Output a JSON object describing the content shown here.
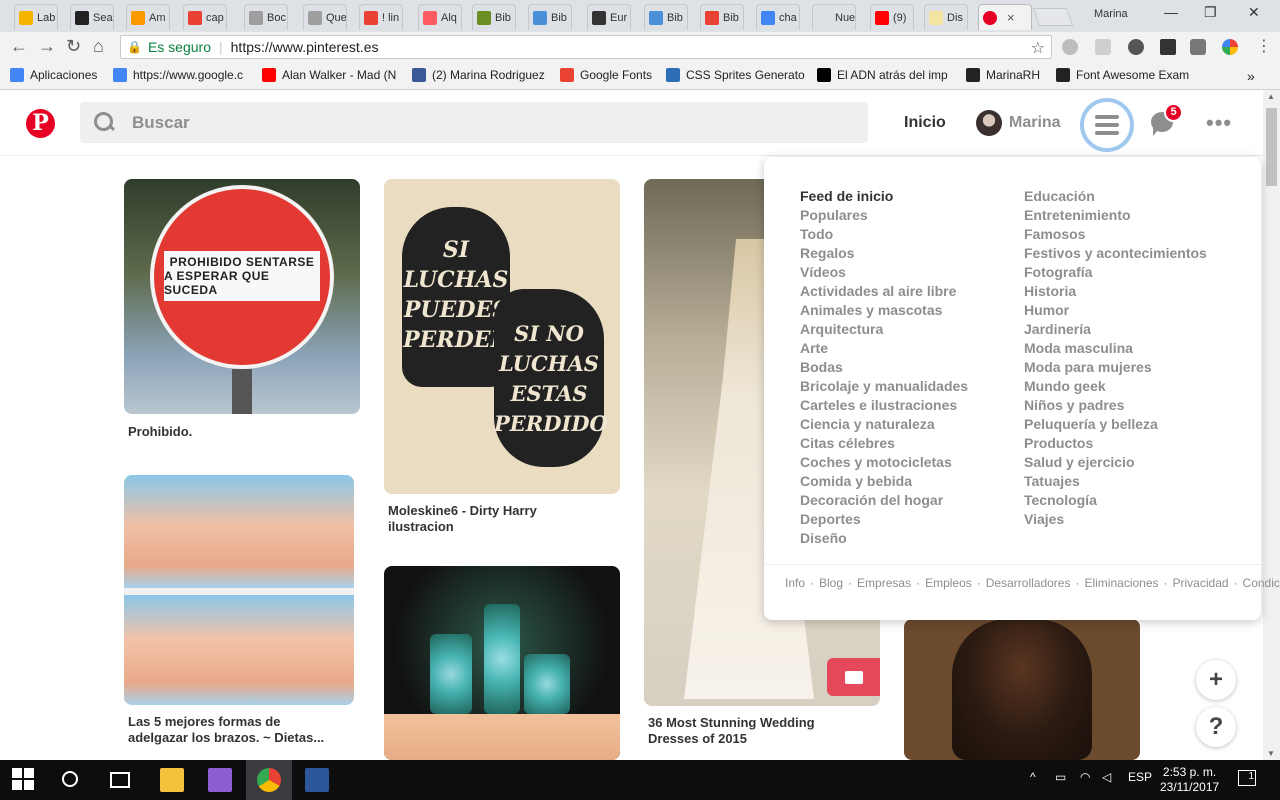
{
  "browser": {
    "tabs": [
      {
        "label": "Lab",
        "color": "#f4b400"
      },
      {
        "label": "Sea",
        "color": "#222222"
      },
      {
        "label": "Am",
        "color": "#ff9900"
      },
      {
        "label": "cap",
        "color": "#e94235"
      },
      {
        "label": "Boc",
        "color": "#9e9e9e"
      },
      {
        "label": "Que",
        "color": "#9e9e9e"
      },
      {
        "label": "! lin",
        "color": "#e94235"
      },
      {
        "label": "Alq",
        "color": "#ff5a5f"
      },
      {
        "label": "Bib",
        "color": "#6b8e23"
      },
      {
        "label": "Bib",
        "color": "#4a90d9"
      },
      {
        "label": "Eur",
        "color": "#333333"
      },
      {
        "label": "Bib",
        "color": "#4a90d9"
      },
      {
        "label": "Bib",
        "color": "#e94235"
      },
      {
        "label": "cha",
        "color": "#4285f4"
      },
      {
        "label": "Nueva",
        "color": "#dde0e4"
      },
      {
        "label": "(9)",
        "color": "#ff0000"
      },
      {
        "label": "Dis",
        "color": "#f4e4a1"
      }
    ],
    "active_tab_close": "×",
    "profile_name": "Marina",
    "window_controls": [
      "—",
      "❐",
      "✕"
    ],
    "nav": {
      "back": "←",
      "forward": "→",
      "reload": "↻",
      "home": "⌂"
    },
    "address": {
      "secure_label": "Es seguro",
      "separator": "|",
      "url": "https://www.pinterest.es",
      "star": "☆"
    },
    "bookmarks": [
      {
        "label": "Aplicaciones",
        "icon": "apps-icon",
        "color": "#4285f4"
      },
      {
        "label": "https://www.google.c",
        "icon": "google-icon",
        "color": "#4285f4"
      },
      {
        "label": "Alan Walker - Mad (N",
        "icon": "youtube-icon",
        "color": "#ff0000"
      },
      {
        "label": "(2) Marina Rodriguez",
        "icon": "facebook-icon",
        "color": "#3b5998"
      },
      {
        "label": "Google Fonts",
        "icon": "fonts-icon",
        "color": "#ea4335"
      },
      {
        "label": "CSS Sprites Generato",
        "icon": "sprites-icon",
        "color": "#2c6fb7"
      },
      {
        "label": "El ADN atrás del imp",
        "icon": "medium-icon",
        "color": "#000000"
      },
      {
        "label": "MarinaRH",
        "icon": "github-icon",
        "color": "#222222"
      },
      {
        "label": "Font Awesome Exam",
        "icon": "fontawesome-icon",
        "color": "#222222"
      }
    ],
    "bookmarks_overflow": "»"
  },
  "pinterest": {
    "logo": "P",
    "search_placeholder": "Buscar",
    "home_link": "Inicio",
    "user_name": "Marina",
    "notifications_count": "5",
    "more": "•••",
    "brand_color": "#e60023"
  },
  "pins": [
    {
      "title": "Prohibido.",
      "image_text_1": "PROHIBIDO SENTARSE",
      "image_text_2": "A ESPERAR QUE SUCEDA"
    },
    {
      "title": "Moleskine6 - Dirty Harry ilustracion",
      "image_text_1": "SI LUCHAS PUEDES PERDER",
      "image_text_2": "SI NO LUCHAS ESTAS PERDIDO"
    },
    {
      "title": "36 Most Stunning Wedding Dresses of 2015"
    },
    {
      "title": "Las 5 mejores formas de adelgazar los brazos. ~ Dietas..."
    },
    {
      "title": ""
    },
    {
      "title": ""
    }
  ],
  "menu": {
    "left": [
      "Feed de inicio",
      "Populares",
      "Todo",
      "Regalos",
      "Vídeos",
      "Actividades al aire libre",
      "Animales y mascotas",
      "Arquitectura",
      "Arte",
      "Bodas",
      "Bricolaje y manualidades",
      "Carteles e ilustraciones",
      "Ciencia y naturaleza",
      "Citas célebres",
      "Coches y motocicletas",
      "Comida y bebida",
      "Decoración del hogar",
      "Deportes",
      "Diseño"
    ],
    "right": [
      "Educación",
      "Entretenimiento",
      "Famosos",
      "Festivos y acontecimientos",
      "Fotografía",
      "Historia",
      "Humor",
      "Jardinería",
      "Moda masculina",
      "Moda para mujeres",
      "Mundo geek",
      "Niños y padres",
      "Peluquería y belleza",
      "Productos",
      "Salud y ejercicio",
      "Tatuajes",
      "Tecnología",
      "Viajes"
    ],
    "footer": [
      "Info",
      "Blog",
      "Empresas",
      "Empleos",
      "Desarrolladores",
      "Eliminaciones",
      "Privacidad",
      "Condiciones"
    ],
    "footer_sep": "·"
  },
  "fab": {
    "add": "+",
    "help": "?"
  },
  "taskbar": {
    "language": "ESP",
    "time": "2:53 p. m.",
    "date": "23/11/2017",
    "notifications": "1"
  }
}
